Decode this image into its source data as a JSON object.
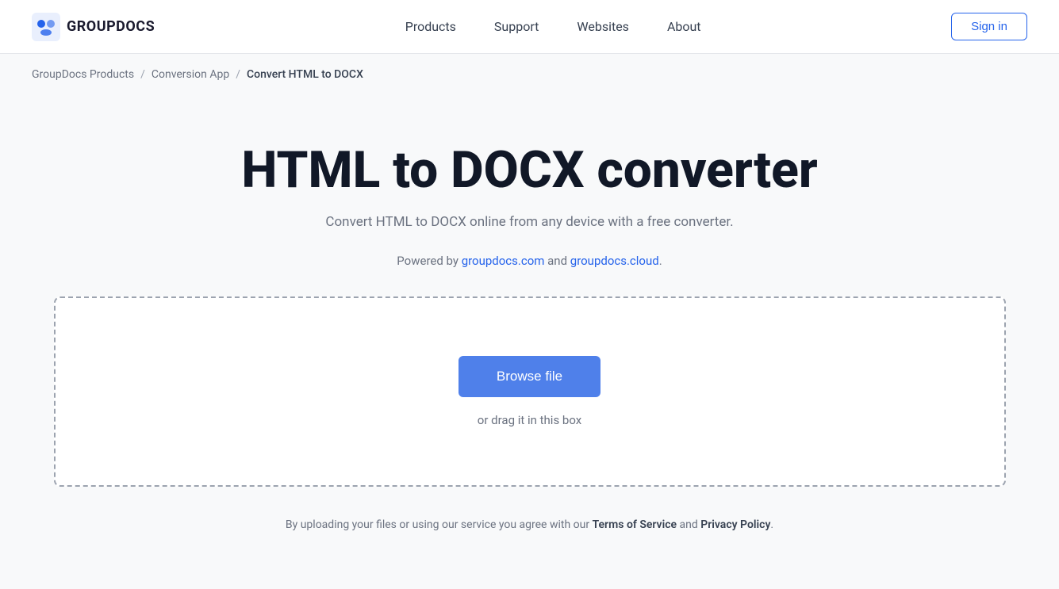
{
  "brand": {
    "logo_text": "GROUPDOCS",
    "logo_alt": "GroupDocs Logo"
  },
  "navbar": {
    "links": [
      {
        "label": "Products",
        "id": "products"
      },
      {
        "label": "Support",
        "id": "support"
      },
      {
        "label": "Websites",
        "id": "websites"
      },
      {
        "label": "About",
        "id": "about"
      }
    ],
    "signin_label": "Sign in"
  },
  "breadcrumb": {
    "items": [
      {
        "label": "GroupDocs Products",
        "active": false
      },
      {
        "label": "Conversion App",
        "active": false
      },
      {
        "label": "Convert HTML to DOCX",
        "active": true
      }
    ]
  },
  "main": {
    "title": "HTML to DOCX converter",
    "subtitle": "Convert HTML to DOCX online from any device with a free converter.",
    "powered_by_prefix": "Powered by ",
    "powered_by_link1_label": "groupdocs.com",
    "powered_by_link1_url": "#",
    "powered_by_and": " and ",
    "powered_by_link2_label": "groupdocs.cloud",
    "powered_by_link2_url": "#",
    "powered_by_suffix": ".",
    "browse_btn_label": "Browse file",
    "drag_text": "or drag it in this box"
  },
  "footer": {
    "text_prefix": "By uploading your files or using our service you agree with our ",
    "tos_label": "Terms of Service",
    "and": " and ",
    "privacy_label": "Privacy Policy",
    "text_suffix": "."
  }
}
